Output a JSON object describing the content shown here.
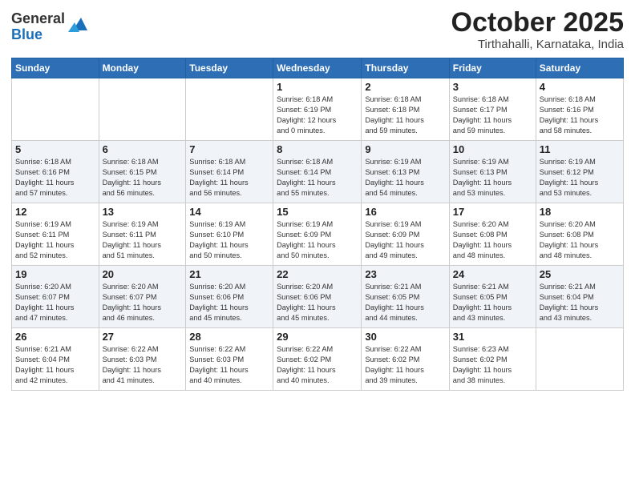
{
  "header": {
    "logo_general": "General",
    "logo_blue": "Blue",
    "month": "October 2025",
    "location": "Tirthahalli, Karnataka, India"
  },
  "days_of_week": [
    "Sunday",
    "Monday",
    "Tuesday",
    "Wednesday",
    "Thursday",
    "Friday",
    "Saturday"
  ],
  "weeks": [
    [
      {
        "num": "",
        "info": ""
      },
      {
        "num": "",
        "info": ""
      },
      {
        "num": "",
        "info": ""
      },
      {
        "num": "1",
        "info": "Sunrise: 6:18 AM\nSunset: 6:19 PM\nDaylight: 12 hours\nand 0 minutes."
      },
      {
        "num": "2",
        "info": "Sunrise: 6:18 AM\nSunset: 6:18 PM\nDaylight: 11 hours\nand 59 minutes."
      },
      {
        "num": "3",
        "info": "Sunrise: 6:18 AM\nSunset: 6:17 PM\nDaylight: 11 hours\nand 59 minutes."
      },
      {
        "num": "4",
        "info": "Sunrise: 6:18 AM\nSunset: 6:16 PM\nDaylight: 11 hours\nand 58 minutes."
      }
    ],
    [
      {
        "num": "5",
        "info": "Sunrise: 6:18 AM\nSunset: 6:16 PM\nDaylight: 11 hours\nand 57 minutes."
      },
      {
        "num": "6",
        "info": "Sunrise: 6:18 AM\nSunset: 6:15 PM\nDaylight: 11 hours\nand 56 minutes."
      },
      {
        "num": "7",
        "info": "Sunrise: 6:18 AM\nSunset: 6:14 PM\nDaylight: 11 hours\nand 56 minutes."
      },
      {
        "num": "8",
        "info": "Sunrise: 6:18 AM\nSunset: 6:14 PM\nDaylight: 11 hours\nand 55 minutes."
      },
      {
        "num": "9",
        "info": "Sunrise: 6:19 AM\nSunset: 6:13 PM\nDaylight: 11 hours\nand 54 minutes."
      },
      {
        "num": "10",
        "info": "Sunrise: 6:19 AM\nSunset: 6:13 PM\nDaylight: 11 hours\nand 53 minutes."
      },
      {
        "num": "11",
        "info": "Sunrise: 6:19 AM\nSunset: 6:12 PM\nDaylight: 11 hours\nand 53 minutes."
      }
    ],
    [
      {
        "num": "12",
        "info": "Sunrise: 6:19 AM\nSunset: 6:11 PM\nDaylight: 11 hours\nand 52 minutes."
      },
      {
        "num": "13",
        "info": "Sunrise: 6:19 AM\nSunset: 6:11 PM\nDaylight: 11 hours\nand 51 minutes."
      },
      {
        "num": "14",
        "info": "Sunrise: 6:19 AM\nSunset: 6:10 PM\nDaylight: 11 hours\nand 50 minutes."
      },
      {
        "num": "15",
        "info": "Sunrise: 6:19 AM\nSunset: 6:09 PM\nDaylight: 11 hours\nand 50 minutes."
      },
      {
        "num": "16",
        "info": "Sunrise: 6:19 AM\nSunset: 6:09 PM\nDaylight: 11 hours\nand 49 minutes."
      },
      {
        "num": "17",
        "info": "Sunrise: 6:20 AM\nSunset: 6:08 PM\nDaylight: 11 hours\nand 48 minutes."
      },
      {
        "num": "18",
        "info": "Sunrise: 6:20 AM\nSunset: 6:08 PM\nDaylight: 11 hours\nand 48 minutes."
      }
    ],
    [
      {
        "num": "19",
        "info": "Sunrise: 6:20 AM\nSunset: 6:07 PM\nDaylight: 11 hours\nand 47 minutes."
      },
      {
        "num": "20",
        "info": "Sunrise: 6:20 AM\nSunset: 6:07 PM\nDaylight: 11 hours\nand 46 minutes."
      },
      {
        "num": "21",
        "info": "Sunrise: 6:20 AM\nSunset: 6:06 PM\nDaylight: 11 hours\nand 45 minutes."
      },
      {
        "num": "22",
        "info": "Sunrise: 6:20 AM\nSunset: 6:06 PM\nDaylight: 11 hours\nand 45 minutes."
      },
      {
        "num": "23",
        "info": "Sunrise: 6:21 AM\nSunset: 6:05 PM\nDaylight: 11 hours\nand 44 minutes."
      },
      {
        "num": "24",
        "info": "Sunrise: 6:21 AM\nSunset: 6:05 PM\nDaylight: 11 hours\nand 43 minutes."
      },
      {
        "num": "25",
        "info": "Sunrise: 6:21 AM\nSunset: 6:04 PM\nDaylight: 11 hours\nand 43 minutes."
      }
    ],
    [
      {
        "num": "26",
        "info": "Sunrise: 6:21 AM\nSunset: 6:04 PM\nDaylight: 11 hours\nand 42 minutes."
      },
      {
        "num": "27",
        "info": "Sunrise: 6:22 AM\nSunset: 6:03 PM\nDaylight: 11 hours\nand 41 minutes."
      },
      {
        "num": "28",
        "info": "Sunrise: 6:22 AM\nSunset: 6:03 PM\nDaylight: 11 hours\nand 40 minutes."
      },
      {
        "num": "29",
        "info": "Sunrise: 6:22 AM\nSunset: 6:02 PM\nDaylight: 11 hours\nand 40 minutes."
      },
      {
        "num": "30",
        "info": "Sunrise: 6:22 AM\nSunset: 6:02 PM\nDaylight: 11 hours\nand 39 minutes."
      },
      {
        "num": "31",
        "info": "Sunrise: 6:23 AM\nSunset: 6:02 PM\nDaylight: 11 hours\nand 38 minutes."
      },
      {
        "num": "",
        "info": ""
      }
    ]
  ]
}
